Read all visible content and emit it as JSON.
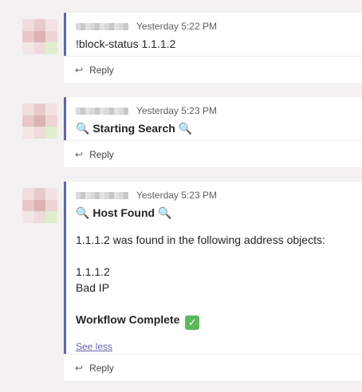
{
  "messages": [
    {
      "time": "Yesterday 5:22 PM",
      "text": "!block-status 1.1.1.2",
      "reply_label": "Reply"
    },
    {
      "time": "Yesterday 5:23 PM",
      "title": "Starting Search",
      "reply_label": "Reply"
    },
    {
      "time": "Yesterday 5:23 PM",
      "title": "Host Found",
      "line1": "1.1.1.2 was found in the following address objects:",
      "line2": "1.1.1.2",
      "line3": "Bad IP",
      "complete": "Workflow Complete",
      "see_less": "See less",
      "reply_label": "Reply"
    }
  ],
  "icons": {
    "magnifier": "magnifying-glass-icon",
    "check": "check-mark-icon",
    "reply": "reply-arrow-icon"
  },
  "colors": {
    "accent": "#6264a7",
    "background": "#f3f2f1",
    "check": "#5cb85c"
  }
}
